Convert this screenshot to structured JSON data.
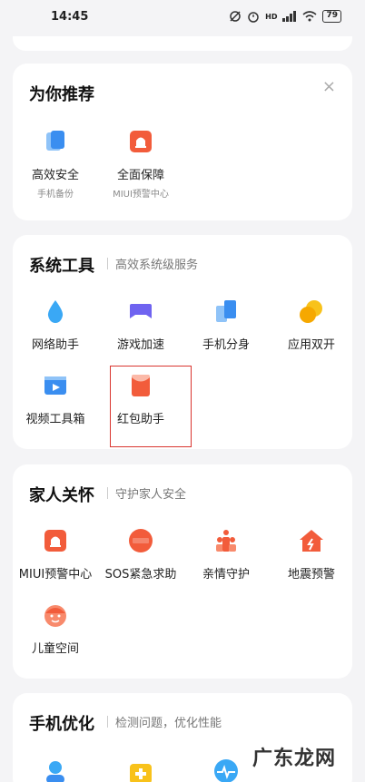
{
  "status_bar": {
    "time": "14:45",
    "icons": [
      "alarm-off-icon",
      "alarm-icon",
      "signal-icon",
      "wifi-icon"
    ],
    "network": "HD",
    "battery": "79"
  },
  "recommend": {
    "title": "为你推荐",
    "close_icon": "×",
    "items": [
      {
        "label": "高效安全",
        "desc": "手机备份",
        "icon": "backup-icon"
      },
      {
        "label": "全面保障",
        "desc": "MIUI预警中心",
        "icon": "alert-center-icon"
      }
    ]
  },
  "system_tools": {
    "title": "系统工具",
    "subtitle": "高效系统级服务",
    "items": [
      {
        "label": "网络助手",
        "icon": "network-drop-icon"
      },
      {
        "label": "游戏加速",
        "icon": "game-pad-icon"
      },
      {
        "label": "手机分身",
        "icon": "dual-phone-icon"
      },
      {
        "label": "应用双开",
        "icon": "dual-app-icon"
      },
      {
        "label": "视频工具箱",
        "icon": "video-toolbox-icon"
      },
      {
        "label": "红包助手",
        "icon": "red-envelope-icon"
      }
    ]
  },
  "family_care": {
    "title": "家人关怀",
    "subtitle": "守护家人安全",
    "items": [
      {
        "label": "MIUI预警中心",
        "icon": "alert-center-icon"
      },
      {
        "label": "SOS紧急求助",
        "icon": "sos-icon"
      },
      {
        "label": "亲情守护",
        "icon": "family-icon"
      },
      {
        "label": "地震预警",
        "icon": "earthquake-icon"
      },
      {
        "label": "儿童空间",
        "icon": "kid-face-icon"
      }
    ]
  },
  "phone_optimize": {
    "title": "手机优化",
    "subtitle": "检测问题，优化性能"
  },
  "watermark": "广东龙网",
  "colors": {
    "blue": "#3a8ef0",
    "orange": "#f25c3b",
    "yellow": "#f8c21b",
    "purple": "#6f63f0",
    "highlight": "#d9352f"
  }
}
